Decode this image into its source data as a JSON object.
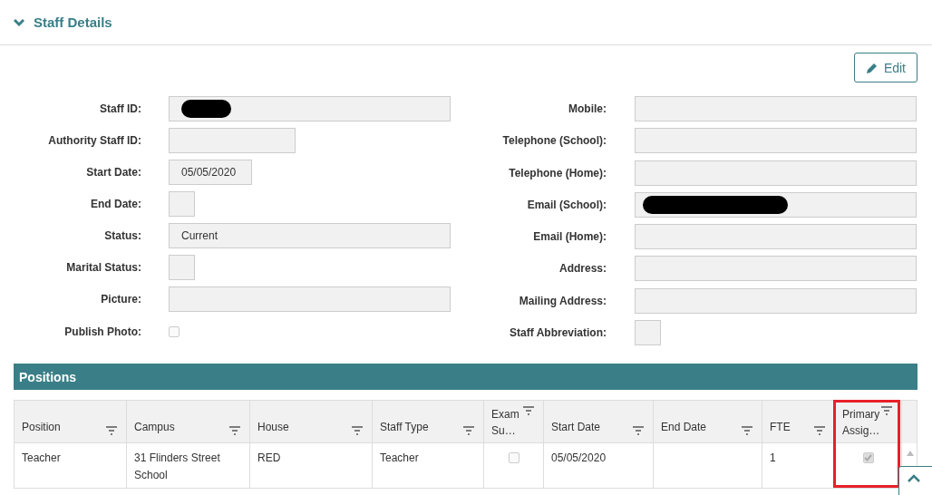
{
  "section": {
    "title": "Staff Details",
    "expanded": true
  },
  "edit_button": {
    "label": "Edit"
  },
  "left_fields": [
    {
      "label": "Staff ID:",
      "kind": "wide",
      "redacted": true
    },
    {
      "label": "Authority Staff ID:",
      "kind": "medium",
      "redacted": false
    },
    {
      "label": "Start Date:",
      "kind": "short",
      "value": "05/05/2020",
      "redacted": false
    },
    {
      "label": "End Date:",
      "kind": "tiny",
      "redacted": false
    },
    {
      "label": "Status:",
      "kind": "wide",
      "value": "Current",
      "redacted": false
    },
    {
      "label": "Marital Status:",
      "kind": "tiny",
      "redacted": false
    },
    {
      "label": "Picture:",
      "kind": "wide",
      "redacted": false
    },
    {
      "label": "Publish Photo:",
      "kind": "checkbox",
      "checked": false
    }
  ],
  "right_fields": [
    {
      "label": "Mobile:",
      "kind": "wide",
      "redacted": false
    },
    {
      "label": "Telephone (School):",
      "kind": "wide",
      "redacted": false
    },
    {
      "label": "Telephone (Home):",
      "kind": "wide",
      "redacted": false
    },
    {
      "label": "Email (School):",
      "kind": "wide",
      "redacted": true
    },
    {
      "label": "Email (Home):",
      "kind": "wide",
      "redacted": false
    },
    {
      "label": "Address:",
      "kind": "wide",
      "redacted": false
    },
    {
      "label": "Mailing Address:",
      "kind": "wide",
      "redacted": false
    },
    {
      "label": "Staff Abbreviation:",
      "kind": "tiny",
      "redacted": false
    }
  ],
  "positions": {
    "title": "Positions",
    "columns": [
      {
        "label": "Position",
        "highlighted": false
      },
      {
        "label": "Campus",
        "highlighted": false
      },
      {
        "label": "House",
        "highlighted": false
      },
      {
        "label": "Staff Type",
        "highlighted": false
      },
      {
        "label": "Exam Su…",
        "highlighted": false
      },
      {
        "label": "Start Date",
        "highlighted": false
      },
      {
        "label": "End Date",
        "highlighted": false
      },
      {
        "label": "FTE",
        "highlighted": false
      },
      {
        "label": "Primary Assig…",
        "highlighted": true
      }
    ],
    "rows": [
      {
        "cells": [
          {
            "kind": "text",
            "text": "Teacher"
          },
          {
            "kind": "text",
            "text": "31 Flinders Street School"
          },
          {
            "kind": "text",
            "text": "RED"
          },
          {
            "kind": "text",
            "text": "Teacher"
          },
          {
            "kind": "checkbox",
            "checked": false
          },
          {
            "kind": "text",
            "text": "05/05/2020"
          },
          {
            "kind": "empty"
          },
          {
            "kind": "text",
            "text": "1"
          },
          {
            "kind": "checkbox",
            "checked": true
          }
        ]
      }
    ]
  }
}
